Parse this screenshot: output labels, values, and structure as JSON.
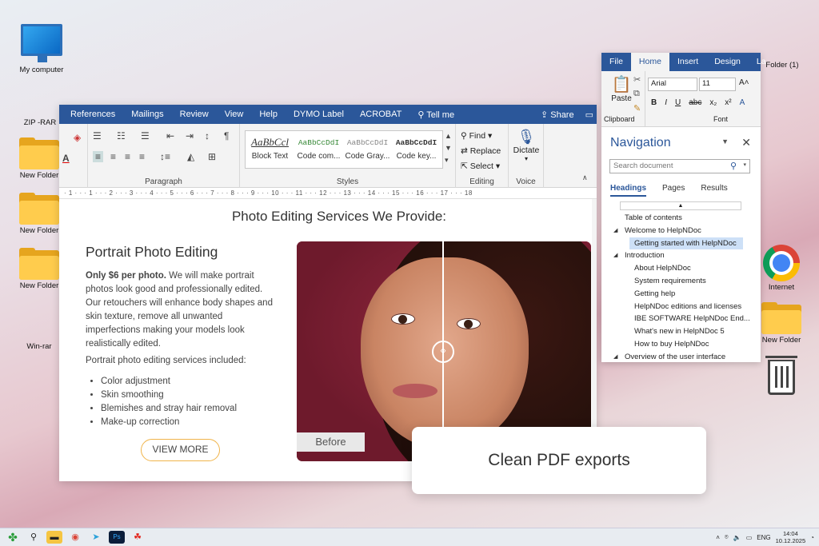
{
  "desktop": {
    "icons_left": [
      {
        "label": "My computer",
        "icon": "monitor-icon"
      },
      {
        "label": "ZIP -RAR",
        "icon": "binders-icon"
      },
      {
        "label": "New Folder",
        "icon": "folder-icon"
      },
      {
        "label": "New Folder",
        "icon": "folder-icon"
      },
      {
        "label": "New Folder",
        "icon": "folder-icon"
      },
      {
        "label": "Win-rar",
        "icon": "winrar-icon"
      }
    ],
    "icons_right": [
      {
        "label": "",
        "icon": "binders-icon"
      },
      {
        "label": "Folder (1)",
        "icon": "binders-icon"
      },
      {
        "label": "Internet",
        "icon": "chrome-icon"
      },
      {
        "label": "New Folder",
        "icon": "folder-icon"
      },
      {
        "label": "",
        "icon": "trash-icon"
      }
    ]
  },
  "word": {
    "tabs": [
      "References",
      "Mailings",
      "Review",
      "View",
      "Help",
      "DYMO Label",
      "ACROBAT"
    ],
    "tell_me": "Tell me",
    "share": "Share",
    "groups": {
      "paragraph": "Paragraph",
      "styles": "Styles",
      "editing": "Editing",
      "voice": "Voice"
    },
    "styles": [
      {
        "sample": "AaBbCcl",
        "name": "Block Text"
      },
      {
        "sample": "AaBbCcDdI",
        "name": "Code com..."
      },
      {
        "sample": "AaBbCcDdI",
        "name": "Code Gray..."
      },
      {
        "sample": "AaBbCcDdI",
        "name": "Code key..."
      }
    ],
    "editing": {
      "find": "Find",
      "replace": "Replace",
      "select": "Select"
    },
    "voice": {
      "dictate": "Dictate"
    },
    "ruler": "· 1 · · · 1 · · · 2 · · · 3 · · · 4 · · · 5 · · · 6 · · · 7 · · · 8 · · · 9 · · · 10 · · · 11 · · · 12 · · · 13 · · · 14 · · · 15 · · · 16 · · · 17 · · · 18"
  },
  "doc": {
    "title": "Photo Editing Services We Provide:",
    "section_title": "Portrait Photo Editing",
    "lead_bold": "Only $6 per photo.",
    "lead_text": " We will make portrait photos look good and professionally edited. Our retouchers will enhance body shapes and skin texture, remove all unwanted imperfections making your models look realistically edited.",
    "included_label": "Portrait photo editing services included:",
    "items": [
      "Color adjustment",
      "Skin smoothing",
      "Blemishes and stray hair removal",
      "Make-up correction"
    ],
    "view_more": "VIEW MORE",
    "before_label": "Before"
  },
  "nav": {
    "tabs": [
      "File",
      "Home",
      "Insert",
      "Design",
      "La"
    ],
    "active_tab": "Home",
    "clipboard": {
      "paste": "Paste",
      "label": "Clipboard"
    },
    "font": {
      "name": "Arial",
      "size": "11",
      "label": "Font"
    },
    "title": "Navigation",
    "search_placeholder": "Search document",
    "subtabs": [
      "Headings",
      "Pages",
      "Results"
    ],
    "tree": [
      {
        "text": "Table of contents",
        "level": 0,
        "toggle": ""
      },
      {
        "text": "Welcome to HelpNDoc",
        "level": 0,
        "toggle": "◢"
      },
      {
        "text": "Getting started with HelpNDoc",
        "level": 1,
        "toggle": "",
        "selected": true
      },
      {
        "text": "Introduction",
        "level": 0,
        "toggle": "◢"
      },
      {
        "text": "About HelpNDoc",
        "level": 1,
        "toggle": ""
      },
      {
        "text": "System requirements",
        "level": 1,
        "toggle": ""
      },
      {
        "text": "Getting help",
        "level": 1,
        "toggle": ""
      },
      {
        "text": "HelpNDoc editions and licenses",
        "level": 1,
        "toggle": ""
      },
      {
        "text": "IBE SOFTWARE HelpNDoc End...",
        "level": 1,
        "toggle": ""
      },
      {
        "text": "What's new in HelpNDoc 5",
        "level": 1,
        "toggle": ""
      },
      {
        "text": "How to buy HelpNDoc",
        "level": 1,
        "toggle": ""
      },
      {
        "text": "Overview of the user interface",
        "level": 0,
        "toggle": "◢"
      }
    ]
  },
  "toast": {
    "text": "Clean PDF exports"
  },
  "taskbar": {
    "lang": "ENG",
    "time": "14:04",
    "date": "10.12.2025"
  }
}
